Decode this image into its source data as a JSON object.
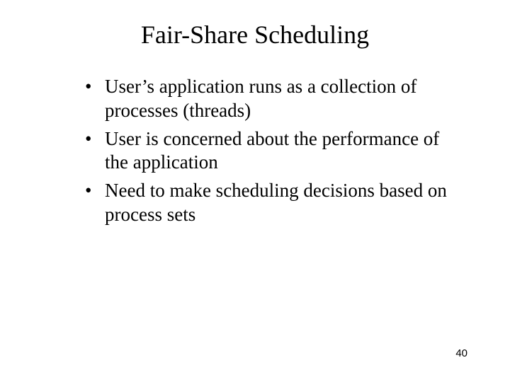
{
  "title": "Fair-Share Scheduling",
  "bullets": [
    "User’s application runs as a collection of processes (threads)",
    "User is concerned about the performance of the application",
    "Need to make scheduling decisions based on process sets"
  ],
  "page_number": "40"
}
